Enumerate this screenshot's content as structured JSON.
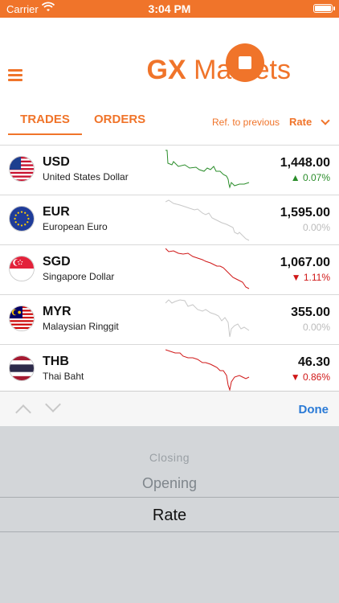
{
  "status_bar": {
    "carrier": "Carrier",
    "time": "3:04 PM"
  },
  "header": {
    "title_bold": "GX",
    "title_rest": "Markets"
  },
  "tabs": {
    "trades": "TRADES",
    "orders": "ORDERS"
  },
  "ref": {
    "label": "Ref. to previous",
    "value": "Rate"
  },
  "currencies": [
    {
      "code": "USD",
      "name": "United States Dollar",
      "price": "1,448.00",
      "change": "0.07%",
      "direction": "up",
      "color": "#2a8d2a"
    },
    {
      "code": "EUR",
      "name": "European Euro",
      "price": "1,595.00",
      "change": "0.00%",
      "direction": "flat",
      "color": "#c8c8c8"
    },
    {
      "code": "SGD",
      "name": "Singapore Dollar",
      "price": "1,067.00",
      "change": "1.11%",
      "direction": "down",
      "color": "#d01818"
    },
    {
      "code": "MYR",
      "name": "Malaysian Ringgit",
      "price": "355.00",
      "change": "0.00%",
      "direction": "flat",
      "color": "#c8c8c8"
    },
    {
      "code": "THB",
      "name": "Thai Baht",
      "price": "46.30",
      "change": "0.86%",
      "direction": "down",
      "color": "#d01818"
    }
  ],
  "picker_toolbar": {
    "done": "Done"
  },
  "picker": {
    "options": [
      "Closing",
      "Opening",
      "Rate"
    ],
    "selected": "Rate"
  },
  "colors": {
    "accent": "#f0742a",
    "up": "#2a8d2a",
    "down": "#d01818",
    "flat": "#c8c8c8",
    "done": "#2a7ad6"
  }
}
